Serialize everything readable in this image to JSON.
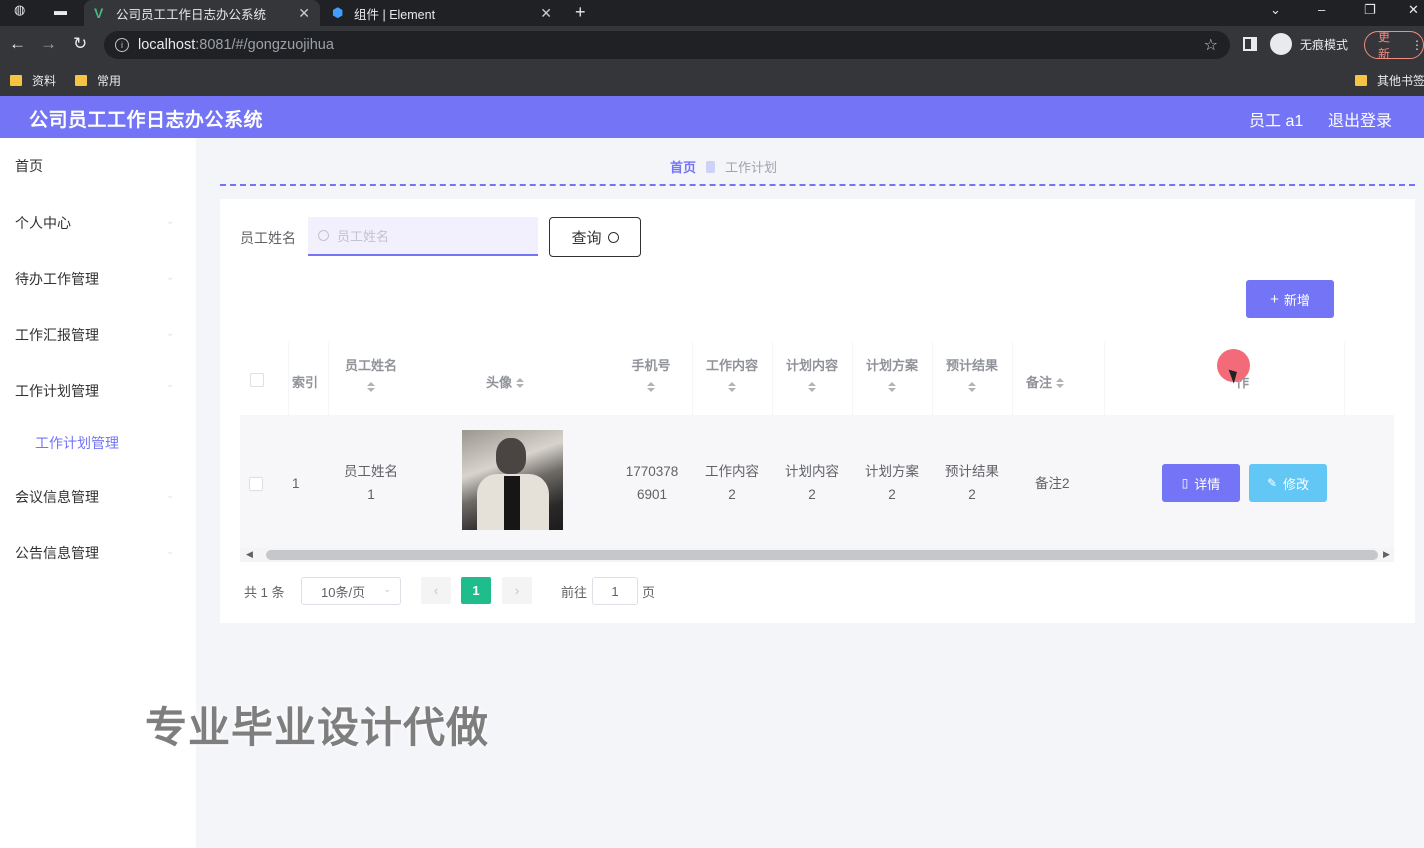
{
  "browser": {
    "tabs": [
      {
        "title": "公司员工工作日志办公系统"
      },
      {
        "title": "组件 | Element"
      }
    ],
    "url_host": "localhost",
    "url_path": ":8081/#/gongzuojihua",
    "incognito_label": "无痕模式",
    "update_label": "更新",
    "bookmarks": [
      "资料",
      "常用"
    ],
    "other_bookmarks": "其他书签"
  },
  "header": {
    "title": "公司员工工作日志办公系统",
    "user": "员工 a1",
    "logout": "退出登录"
  },
  "sidebar": {
    "items": [
      {
        "label": "首页"
      },
      {
        "label": "个人中心"
      },
      {
        "label": "待办工作管理"
      },
      {
        "label": "工作汇报管理"
      },
      {
        "label": "工作计划管理"
      },
      {
        "label": "工作计划管理"
      },
      {
        "label": "会议信息管理"
      },
      {
        "label": "公告信息管理"
      }
    ]
  },
  "breadcrumb": {
    "home": "首页",
    "current": "工作计划"
  },
  "search": {
    "label": "员工姓名",
    "placeholder": "员工姓名",
    "button": "查询"
  },
  "toolbar": {
    "add": "新增"
  },
  "table": {
    "headers": {
      "index": "索引",
      "name": "员工姓名",
      "avatar": "头像",
      "phone": "手机号",
      "work": "工作内容",
      "plan": "计划内容",
      "scheme": "计划方案",
      "result": "预计结果",
      "remark": "备注",
      "actions": "作"
    },
    "rows": [
      {
        "index": "1",
        "name_a": "员工姓名",
        "name_b": "1",
        "phone_a": "1770378",
        "phone_b": "6901",
        "work_a": "工作内容",
        "work_b": "2",
        "plan_a": "计划内容",
        "plan_b": "2",
        "scheme_a": "计划方案",
        "scheme_b": "2",
        "result_a": "预计结果",
        "result_b": "2",
        "remark": "备注2",
        "detail": "详情",
        "edit": "修改"
      }
    ]
  },
  "pagination": {
    "total": "共 1 条",
    "page_size": "10条/页",
    "current": "1",
    "goto": "前往",
    "goto_value": "1",
    "unit": "页"
  },
  "watermark": "专业毕业设计代做",
  "colors": {
    "primary": "#7474f6",
    "success": "#1fbc8c",
    "info": "#63c7f5"
  }
}
